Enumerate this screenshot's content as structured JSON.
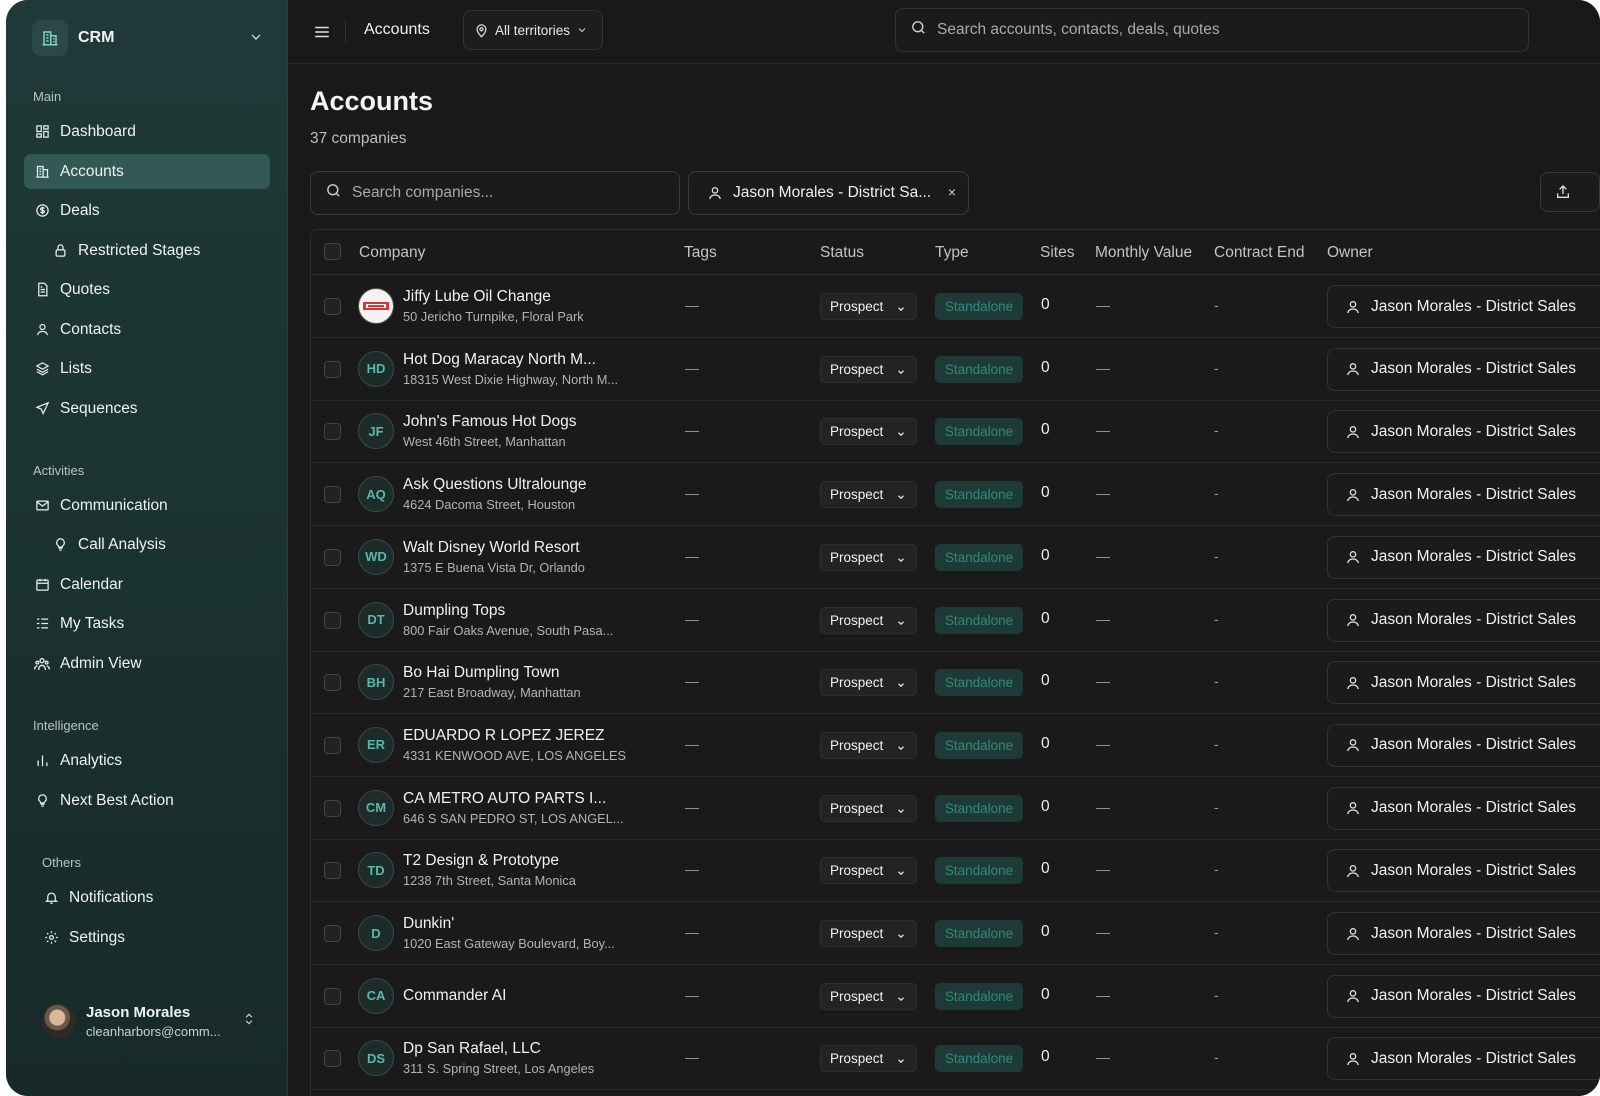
{
  "sidebar": {
    "brand": "CRM",
    "sections": {
      "main": "Main",
      "activities": "Activities",
      "intelligence": "Intelligence",
      "others": "Others"
    },
    "items": {
      "dashboard": "Dashboard",
      "accounts": "Accounts",
      "deals": "Deals",
      "restricted_stages": "Restricted Stages",
      "quotes": "Quotes",
      "contacts": "Contacts",
      "lists": "Lists",
      "sequences": "Sequences",
      "communication": "Communication",
      "call_analysis": "Call Analysis",
      "calendar": "Calendar",
      "my_tasks": "My Tasks",
      "admin_view": "Admin View",
      "analytics": "Analytics",
      "next_best_action": "Next Best Action",
      "notifications": "Notifications",
      "settings": "Settings"
    },
    "user": {
      "name": "Jason Morales",
      "email": "cleanharbors@comm..."
    }
  },
  "topbar": {
    "title": "Accounts",
    "territory": "All territories",
    "search_placeholder": "Search accounts, contacts, deals, quotes"
  },
  "page": {
    "title": "Accounts",
    "subtitle": "37 companies",
    "company_search_placeholder": "Search companies...",
    "owner_filter": "Jason Morales - District Sa...",
    "owner_filter_clear": "×"
  },
  "table": {
    "columns": {
      "company": "Company",
      "tags": "Tags",
      "status": "Status",
      "type": "Type",
      "sites": "Sites",
      "monthly_value": "Monthly Value",
      "contract_end": "Contract End",
      "owner": "Owner"
    },
    "rows": [
      {
        "initials": "",
        "logo": "jiffy-lube-logo",
        "name": "Jiffy Lube Oil Change",
        "address": "50 Jericho Turnpike, Floral Park",
        "tags": "—",
        "status": "Prospect",
        "type": "Standalone",
        "sites": "0",
        "monthly_value": "—",
        "contract_end": "-",
        "owner": "Jason Morales - District Sales"
      },
      {
        "initials": "HD",
        "name": "Hot Dog Maracay North M...",
        "address": "18315 West Dixie Highway, North M...",
        "tags": "—",
        "status": "Prospect",
        "type": "Standalone",
        "sites": "0",
        "monthly_value": "—",
        "contract_end": "-",
        "owner": "Jason Morales - District Sales"
      },
      {
        "initials": "JF",
        "name": "John's Famous Hot Dogs",
        "address": "West 46th Street, Manhattan",
        "tags": "—",
        "status": "Prospect",
        "type": "Standalone",
        "sites": "0",
        "monthly_value": "—",
        "contract_end": "-",
        "owner": "Jason Morales - District Sales"
      },
      {
        "initials": "AQ",
        "name": "Ask Questions Ultralounge",
        "address": "4624 Dacoma Street, Houston",
        "tags": "—",
        "status": "Prospect",
        "type": "Standalone",
        "sites": "0",
        "monthly_value": "—",
        "contract_end": "-",
        "owner": "Jason Morales - District Sales"
      },
      {
        "initials": "WD",
        "name": "Walt Disney World Resort",
        "address": "1375 E Buena Vista Dr, Orlando",
        "tags": "—",
        "status": "Prospect",
        "type": "Standalone",
        "sites": "0",
        "monthly_value": "—",
        "contract_end": "-",
        "owner": "Jason Morales - District Sales"
      },
      {
        "initials": "DT",
        "name": "Dumpling Tops",
        "address": "800 Fair Oaks Avenue, South Pasa...",
        "tags": "—",
        "status": "Prospect",
        "type": "Standalone",
        "sites": "0",
        "monthly_value": "—",
        "contract_end": "-",
        "owner": "Jason Morales - District Sales"
      },
      {
        "initials": "BH",
        "name": "Bo Hai Dumpling Town",
        "address": "217 East Broadway, Manhattan",
        "tags": "—",
        "status": "Prospect",
        "type": "Standalone",
        "sites": "0",
        "monthly_value": "—",
        "contract_end": "-",
        "owner": "Jason Morales - District Sales"
      },
      {
        "initials": "ER",
        "name": "EDUARDO R LOPEZ JEREZ",
        "address": "4331 KENWOOD AVE, LOS ANGELES",
        "tags": "—",
        "status": "Prospect",
        "type": "Standalone",
        "sites": "0",
        "monthly_value": "—",
        "contract_end": "-",
        "owner": "Jason Morales - District Sales"
      },
      {
        "initials": "CM",
        "name": "CA METRO AUTO PARTS I...",
        "address": "646 S SAN PEDRO ST, LOS ANGEL...",
        "tags": "—",
        "status": "Prospect",
        "type": "Standalone",
        "sites": "0",
        "monthly_value": "—",
        "contract_end": "-",
        "owner": "Jason Morales - District Sales"
      },
      {
        "initials": "TD",
        "name": "T2 Design & Prototype",
        "address": "1238 7th Street, Santa Monica",
        "tags": "—",
        "status": "Prospect",
        "type": "Standalone",
        "sites": "0",
        "monthly_value": "—",
        "contract_end": "-",
        "owner": "Jason Morales - District Sales"
      },
      {
        "initials": "D",
        "name": "Dunkin'",
        "address": "1020 East Gateway Boulevard, Boy...",
        "tags": "—",
        "status": "Prospect",
        "type": "Standalone",
        "sites": "0",
        "monthly_value": "—",
        "contract_end": "-",
        "owner": "Jason Morales - District Sales"
      },
      {
        "initials": "CA",
        "name": "Commander AI",
        "address": "",
        "tags": "—",
        "status": "Prospect",
        "type": "Standalone",
        "sites": "0",
        "monthly_value": "—",
        "contract_end": "-",
        "owner": "Jason Morales - District Sales"
      },
      {
        "initials": "DS",
        "name": "Dp San Rafael, LLC",
        "address": "311 S. Spring Street, Los Angeles",
        "tags": "—",
        "status": "Prospect",
        "type": "Standalone",
        "sites": "0",
        "monthly_value": "—",
        "contract_end": "-",
        "owner": "Jason Morales - District Sales"
      }
    ]
  },
  "colors": {
    "accent": "#325955",
    "type_badge_text": "#2f8a7e",
    "initials": "#59b8aa"
  }
}
